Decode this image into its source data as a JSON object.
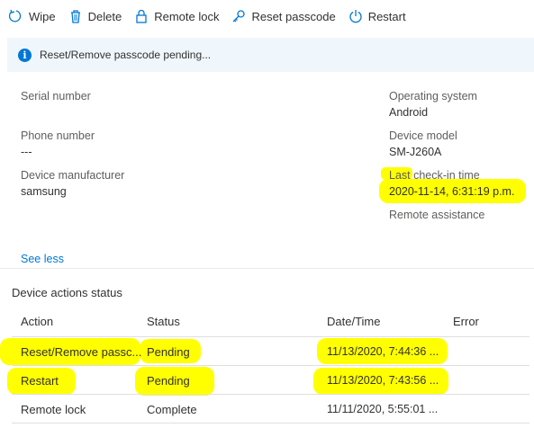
{
  "toolbar": {
    "items": [
      {
        "label": "Wipe",
        "icon": "wipe-icon"
      },
      {
        "label": "Delete",
        "icon": "trash-icon"
      },
      {
        "label": "Remote lock",
        "icon": "lock-icon"
      },
      {
        "label": "Reset passcode",
        "icon": "key-icon"
      },
      {
        "label": "Restart",
        "icon": "power-icon"
      }
    ]
  },
  "banner": {
    "message": "Reset/Remove passcode pending...",
    "icon": "info-icon",
    "color": "#0078d4"
  },
  "properties": {
    "serial_number": {
      "label": "Serial number",
      "value": ""
    },
    "phone_number": {
      "label": "Phone number",
      "value": "---"
    },
    "device_manufacturer": {
      "label": "Device manufacturer",
      "value": "samsung"
    },
    "operating_system": {
      "label": "Operating system",
      "value": "Android"
    },
    "device_model": {
      "label": "Device model",
      "value": "SM-J260A"
    },
    "last_checkin": {
      "label": "Last check-in time",
      "value": "2020-11-14, 6:31:19 p.m."
    },
    "remote_assistance": {
      "label": "Remote assistance",
      "value": ""
    }
  },
  "see_less": "See less",
  "actions": {
    "title": "Device actions status",
    "columns": [
      "Action",
      "Status",
      "Date/Time",
      "Error"
    ],
    "rows": [
      {
        "action": "Reset/Remove passc...",
        "status": "Pending",
        "datetime": "11/13/2020, 7:44:36 ...",
        "error": ""
      },
      {
        "action": "Restart",
        "status": "Pending",
        "datetime": "11/13/2020, 7:43:56 ...",
        "error": ""
      },
      {
        "action": "Remote lock",
        "status": "Complete",
        "datetime": "11/11/2020, 5:55:01 ...",
        "error": ""
      }
    ]
  },
  "highlight_color": "#ffff00"
}
